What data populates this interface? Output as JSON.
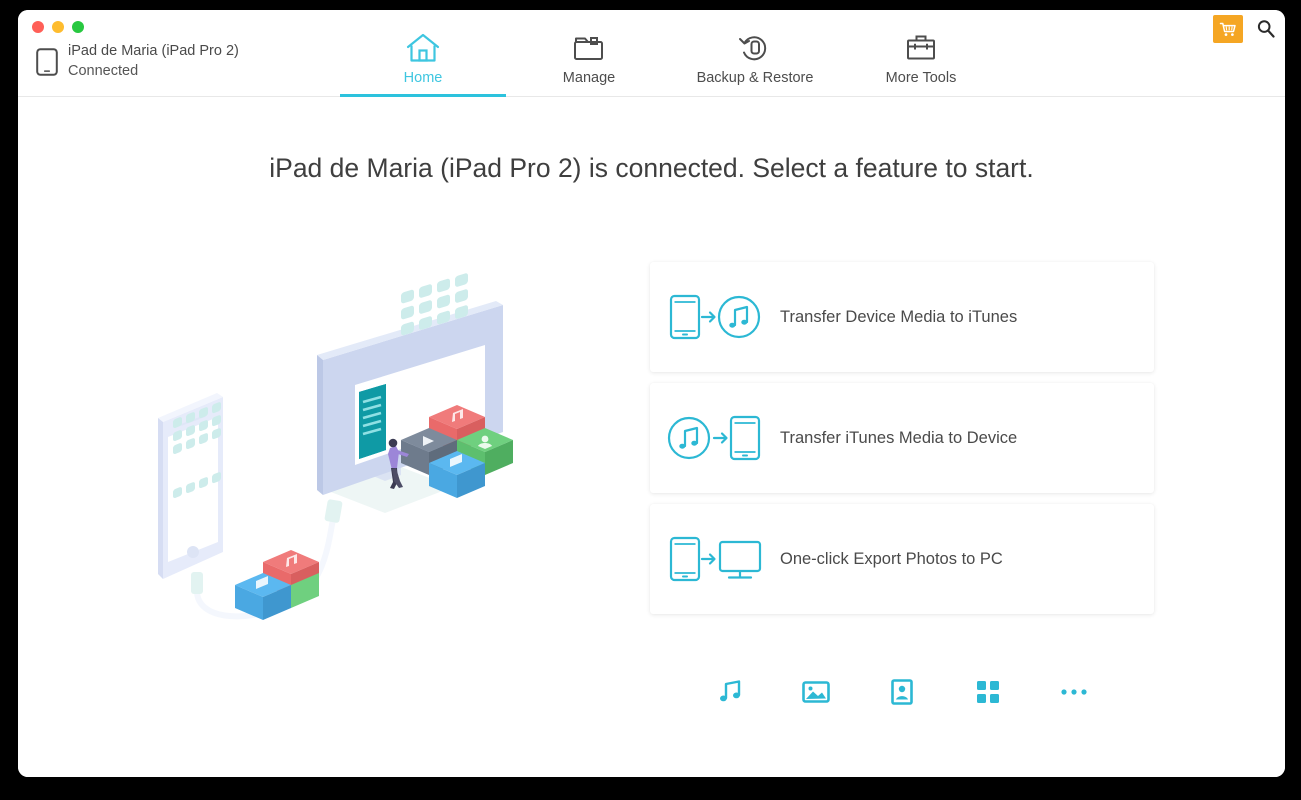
{
  "window": {
    "traffic_lights": [
      {
        "name": "close",
        "color": "#ff5f57"
      },
      {
        "name": "minimize",
        "color": "#febc2e"
      },
      {
        "name": "zoom",
        "color": "#28c840"
      }
    ]
  },
  "header": {
    "device_icon": "ipad-icon",
    "device_name": "iPad de Maria (iPad Pro 2)",
    "device_status": "Connected",
    "tabs": [
      {
        "label": "Home",
        "icon": "home-icon",
        "active": true
      },
      {
        "label": "Manage",
        "icon": "folder-icon",
        "active": false
      },
      {
        "label": "Backup & Restore",
        "icon": "restore-icon",
        "active": false
      },
      {
        "label": "More Tools",
        "icon": "toolbox-icon",
        "active": false
      }
    ],
    "actions": [
      {
        "name": "cart-button",
        "icon": "shopping-cart-icon",
        "background": "#f5a623"
      },
      {
        "name": "search-button",
        "icon": "search-icon"
      }
    ],
    "active_tab_color": "#2cc2dd"
  },
  "main": {
    "headline": "iPad de Maria (iPad Pro 2)  is connected. Select a feature to start.",
    "illustration_alt": "isometric phone connected by cable to a desktop monitor with media boxes",
    "accent_color": "#2cb8d4",
    "cards": [
      {
        "label": "Transfer Device Media to iTunes",
        "icon": "device-to-itunes-icon"
      },
      {
        "label": "Transfer iTunes Media to Device",
        "icon": "itunes-to-device-icon"
      },
      {
        "label": "One-click Export Photos to PC",
        "icon": "device-to-pc-icon"
      }
    ],
    "quick_icons": [
      {
        "name": "music-icon"
      },
      {
        "name": "photos-icon"
      },
      {
        "name": "contacts-icon"
      },
      {
        "name": "apps-grid-icon"
      },
      {
        "name": "more-ellipsis-icon"
      }
    ]
  }
}
